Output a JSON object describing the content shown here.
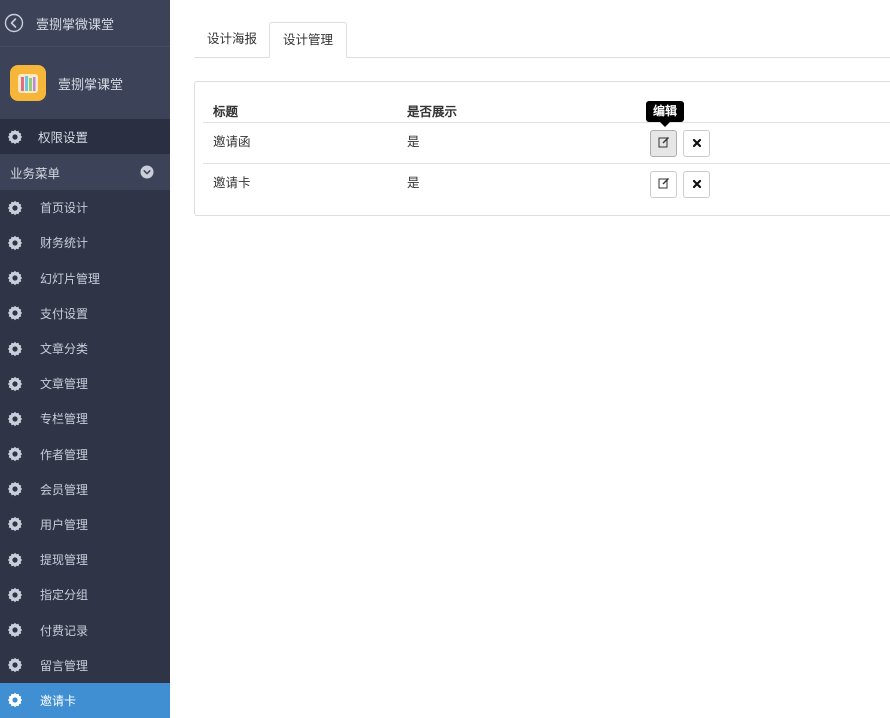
{
  "sidebar": {
    "app_title": "壹捌掌微课堂",
    "profile_name": "壹捌掌课堂",
    "top_items": [
      {
        "label": "权限设置",
        "icon": "gear-icon"
      }
    ],
    "group": {
      "label": "业务菜单",
      "icon": "chevron-down-icon"
    },
    "items": [
      {
        "label": "首页设计",
        "icon": "gear-icon"
      },
      {
        "label": "财务统计",
        "icon": "gear-icon"
      },
      {
        "label": "幻灯片管理",
        "icon": "gear-icon"
      },
      {
        "label": "支付设置",
        "icon": "gear-icon"
      },
      {
        "label": "文章分类",
        "icon": "gear-icon"
      },
      {
        "label": "文章管理",
        "icon": "gear-icon"
      },
      {
        "label": "专栏管理",
        "icon": "gear-icon"
      },
      {
        "label": "作者管理",
        "icon": "gear-icon"
      },
      {
        "label": "会员管理",
        "icon": "gear-icon"
      },
      {
        "label": "用户管理",
        "icon": "gear-icon"
      },
      {
        "label": "提现管理",
        "icon": "gear-icon"
      },
      {
        "label": "指定分组",
        "icon": "gear-icon"
      },
      {
        "label": "付费记录",
        "icon": "gear-icon"
      },
      {
        "label": "留言管理",
        "icon": "gear-icon"
      },
      {
        "label": "邀请卡",
        "icon": "gear-icon",
        "active": true
      }
    ],
    "colors": {
      "background": "#2f3547",
      "header": "#3c4257",
      "active": "#3f8fd2"
    }
  },
  "tabs": [
    {
      "label": "设计海报",
      "active": false
    },
    {
      "label": "设计管理",
      "active": true
    }
  ],
  "table": {
    "columns": [
      "标题",
      "是否展示"
    ],
    "rows": [
      {
        "title": "邀请函",
        "shown": "是"
      },
      {
        "title": "邀请卡",
        "shown": "是"
      }
    ],
    "actions": {
      "edit_icon": "edit-icon",
      "delete_icon": "close-icon"
    },
    "tooltip": "编辑"
  }
}
